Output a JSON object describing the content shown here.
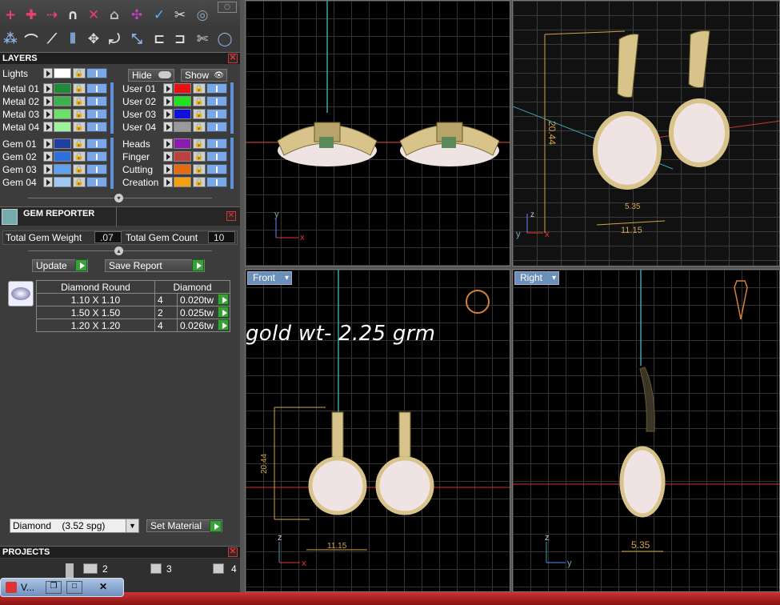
{
  "layers": {
    "title": "LAYERS",
    "lights_label": "Lights",
    "hide_label": "Hide",
    "show_label": "Show",
    "left_column": [
      {
        "label": "Metal 01",
        "color": "#1f8a3a"
      },
      {
        "label": "Metal 02",
        "color": "#3fb050"
      },
      {
        "label": "Metal 03",
        "color": "#6de06a"
      },
      {
        "label": "Metal 04",
        "color": "#9ef09a"
      },
      {
        "label": "Gem 01",
        "color": "#1d3f9f"
      },
      {
        "label": "Gem 02",
        "color": "#2d6fdf"
      },
      {
        "label": "Gem 03",
        "color": "#5fa0ef"
      },
      {
        "label": "Gem 04",
        "color": "#9fc8f5"
      }
    ],
    "right_column": [
      {
        "label": "User 01",
        "color": "#e81010"
      },
      {
        "label": "User 02",
        "color": "#20e020"
      },
      {
        "label": "User 03",
        "color": "#1010d8"
      },
      {
        "label": "User 04",
        "color": "#9a9a9a"
      },
      {
        "label": "Heads",
        "color": "#8a1ab0"
      },
      {
        "label": "Finger",
        "color": "#c04040"
      },
      {
        "label": "Cutting",
        "color": "#e86a10"
      },
      {
        "label": "Creation",
        "color": "#f0a010"
      }
    ]
  },
  "gem_reporter": {
    "title": "GEM REPORTER",
    "total_weight_label": "Total Gem Weight",
    "total_weight_value": ".07",
    "total_count_label": "Total Gem Count",
    "total_count_value": "10",
    "update_label": "Update",
    "save_report_label": "Save Report",
    "table_headers": [
      "Diamond Round",
      "Diamond"
    ],
    "rows": [
      {
        "size": "1.10 X 1.10",
        "count": "4",
        "weight": "0.020tw"
      },
      {
        "size": "1.50 X 1.50",
        "count": "2",
        "weight": "0.025tw"
      },
      {
        "size": "1.20 X 1.20",
        "count": "4",
        "weight": "0.026tw"
      }
    ],
    "material_select": "Diamond    (3.52 spg)",
    "set_material_label": "Set Material"
  },
  "projects": {
    "title": "PROJECTS",
    "tabs": [
      "2",
      "3",
      "4"
    ]
  },
  "viewports": {
    "front_label": "Front",
    "right_label": "Right",
    "overlay_text": "gold wt- 2.25 grm",
    "dims": {
      "top_right_height": "20.44",
      "top_right_width": "11.15",
      "top_right_depth": "5.35",
      "front_height": "20.44",
      "front_width": "11.15",
      "right_depth": "5.35"
    },
    "axis": {
      "x": "x",
      "y": "y",
      "z": "z"
    }
  },
  "taskbar": {
    "window_label": "V..."
  },
  "colors": {
    "accent_blue": "#6a8fb8",
    "go_green": "#3aa03a",
    "close_red": "#dd3333",
    "gold": "#d8c48a",
    "pearl": "#efe3e3"
  }
}
